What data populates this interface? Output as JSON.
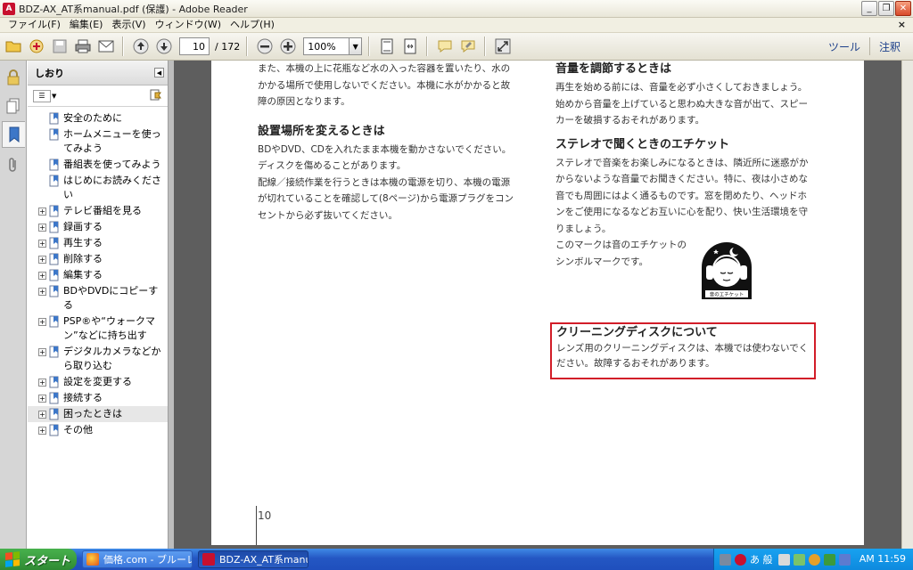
{
  "window": {
    "title": "BDZ-AX_AT系manual.pdf (保護) - Adobe Reader",
    "app_icon_letter": "A"
  },
  "menu": {
    "items": [
      "ファイル(F)",
      "編集(E)",
      "表示(V)",
      "ウィンドウ(W)",
      "ヘルプ(H)"
    ],
    "close_glyph": "×"
  },
  "toolbar": {
    "page_current": "10",
    "page_total": "/ 172",
    "zoom": "100%",
    "tools_label": "ツール",
    "comment_label": "注釈"
  },
  "bookmarks": {
    "title": "しおり",
    "items": [
      {
        "label": "安全のために",
        "expandable": false
      },
      {
        "label": "ホームメニューを使ってみよう",
        "expandable": false
      },
      {
        "label": "番組表を使ってみよう",
        "expandable": false
      },
      {
        "label": "はじめにお読みください",
        "expandable": false
      },
      {
        "label": "テレビ番組を見る",
        "expandable": true
      },
      {
        "label": "録画する",
        "expandable": true
      },
      {
        "label": "再生する",
        "expandable": true
      },
      {
        "label": "削除する",
        "expandable": true
      },
      {
        "label": "編集する",
        "expandable": true
      },
      {
        "label": "BDやDVDにコピーする",
        "expandable": true
      },
      {
        "label": "PSP®や“ウォークマン”などに持ち出す",
        "expandable": true
      },
      {
        "label": "デジタルカメラなどから取り込む",
        "expandable": true
      },
      {
        "label": "設定を変更する",
        "expandable": true
      },
      {
        "label": "接続する",
        "expandable": true
      },
      {
        "label": "困ったときは",
        "expandable": true,
        "selected": true
      },
      {
        "label": "その他",
        "expandable": true
      }
    ]
  },
  "document": {
    "left": {
      "intro": "また、本機の上に花瓶など水の入った容器を置いたり、水のかかる場所で使用しないでください。本機に水がかかると故障の原因となります。",
      "section_title": "設置場所を変えるときは",
      "p1": "BDやDVD、CDを入れたまま本機を動かさないでください。ディスクを傷めることがあります。",
      "p2": "配線／接続作業を行うときは本機の電源を切り、本機の電源が切れていることを確認して(8ページ)から電源プラグをコンセントから必ず抜いてください。"
    },
    "right": {
      "s1_title": "音量を調節するときは",
      "s1_text": "再生を始める前には、音量を必ず小さくしておきましょう。始めから音量を上げていると思わぬ大きな音が出て、スピーカーを破損するおそれがあります。",
      "s2_title": "ステレオで聞くときのエチケット",
      "s2_text": "ステレオで音楽をお楽しみになるときは、隣近所に迷惑がかからないような音量でお聞きください。特に、夜は小さめな音でも周囲にはよく通るものです。窓を閉めたり、ヘッドホンをご使用になるなどお互いに心を配り、快い生活環境を守りましょう。",
      "s2_mark_text": "このマークは音のエチケットのシンボルマークです。",
      "mark_caption": "音のエチケット",
      "s3_title": "クリーニングディスクについて",
      "s3_text": "レンズ用のクリーニングディスクは、本機では使わないでください。故障するおそれがあります。"
    },
    "page_number": "10"
  },
  "taskbar": {
    "start": "スタート",
    "tasks": [
      {
        "label": "価格.com - ブルーレイ...",
        "active": false
      },
      {
        "label": "BDZ-AX_AT系manua...",
        "active": true
      }
    ],
    "ime": "あ 般",
    "clock": "AM 11:59"
  },
  "colors": {
    "highlight_border": "#d21d28",
    "taskbar": "#2457c3",
    "doc_background": "#5e5e5e"
  }
}
